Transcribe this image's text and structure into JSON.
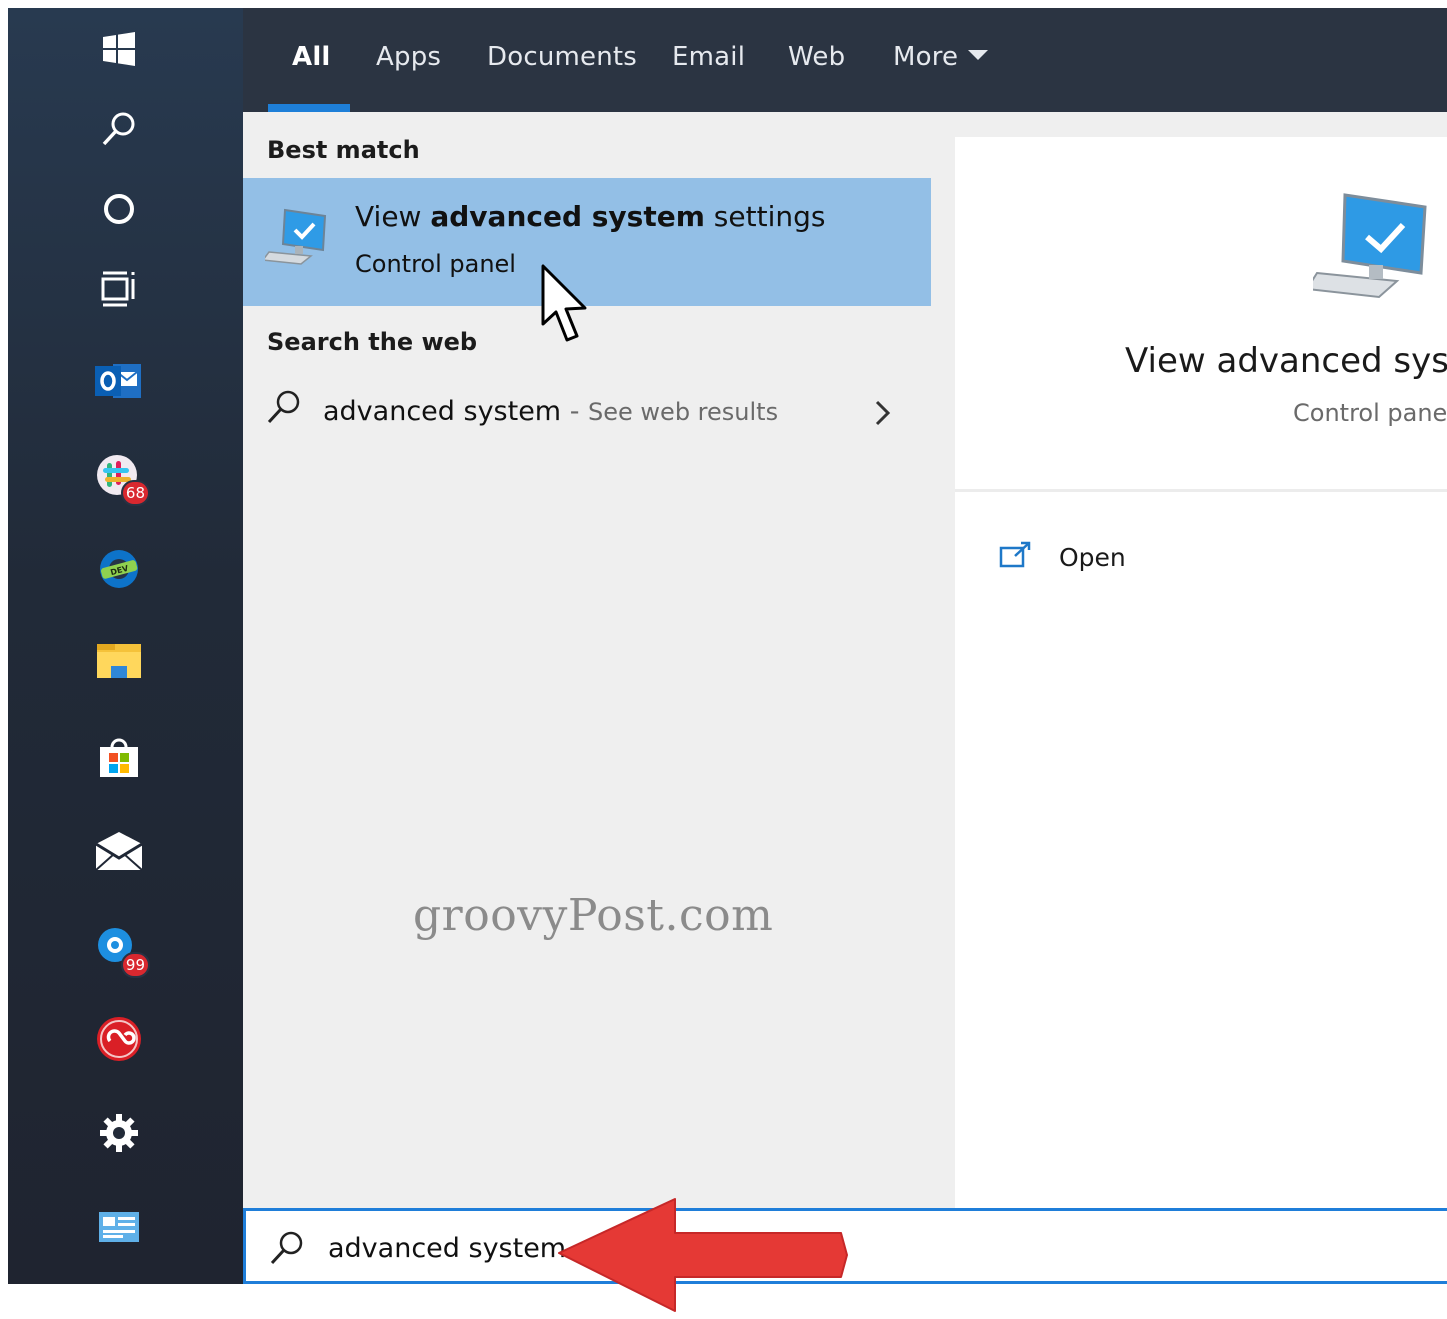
{
  "tabs": [
    {
      "label": "All"
    },
    {
      "label": "Apps"
    },
    {
      "label": "Documents"
    },
    {
      "label": "Email"
    },
    {
      "label": "Web"
    },
    {
      "label": "More"
    }
  ],
  "sections": {
    "best_match": "Best match",
    "search_web": "Search the web"
  },
  "best_match": {
    "title_pre": "View ",
    "title_bold": "advanced system",
    "title_post": " settings",
    "subtitle": "Control panel"
  },
  "web_result": {
    "query": "advanced system",
    "separator": " - ",
    "hint": "See web results"
  },
  "preview": {
    "title": "View advanced syste",
    "subtitle": "Control panel",
    "action_open": "Open"
  },
  "search": {
    "value": "advanced system"
  },
  "taskbar_badges": {
    "slack": "68",
    "skype": "99"
  },
  "watermark": "groovyPost.com",
  "colors": {
    "accent": "#1e7fd8",
    "selected_row": "#93bfe6",
    "header_bg": "#2b3442",
    "annotation_arrow": "#e53935"
  },
  "icons": {
    "taskbar": [
      "windows-start-icon",
      "search-icon",
      "cortana-icon",
      "task-view-icon",
      "outlook-icon",
      "slack-icon",
      "edge-icon",
      "file-explorer-icon",
      "store-icon",
      "mail-icon",
      "skype-icon",
      "creative-cloud-icon",
      "settings-icon",
      "control-panel-icon"
    ]
  }
}
